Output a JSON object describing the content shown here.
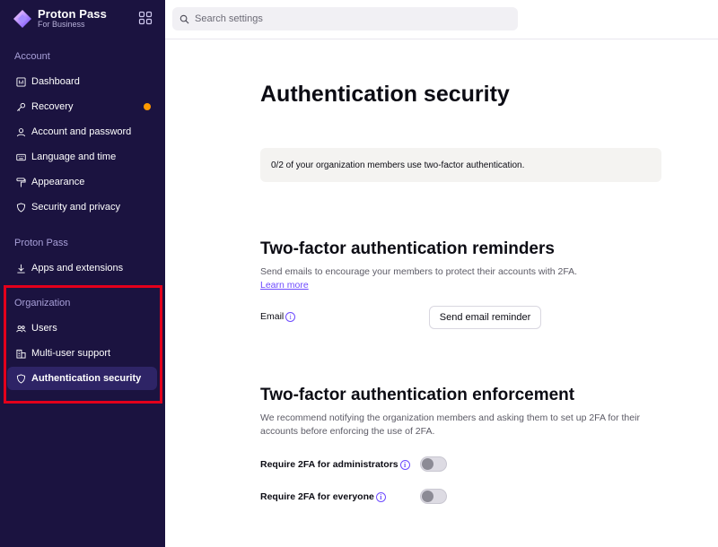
{
  "brand": {
    "name": "Proton Pass",
    "sub": "For Business"
  },
  "search": {
    "placeholder": "Search settings"
  },
  "sidebar": {
    "sections": [
      {
        "title": "Account",
        "items": [
          {
            "label": "Dashboard",
            "icon": "dashboard-icon"
          },
          {
            "label": "Recovery",
            "icon": "key-icon",
            "badge": "warning-dot"
          },
          {
            "label": "Account and password",
            "icon": "user-icon"
          },
          {
            "label": "Language and time",
            "icon": "keyboard-icon"
          },
          {
            "label": "Appearance",
            "icon": "paint-roller-icon"
          },
          {
            "label": "Security and privacy",
            "icon": "shield-icon"
          }
        ]
      },
      {
        "title": "Proton Pass",
        "items": [
          {
            "label": "Apps and extensions",
            "icon": "download-icon"
          }
        ]
      },
      {
        "title": "Organization",
        "items": [
          {
            "label": "Users",
            "icon": "users-icon"
          },
          {
            "label": "Multi-user support",
            "icon": "building-icon"
          },
          {
            "label": "Authentication security",
            "icon": "shield-icon",
            "active": true
          }
        ]
      }
    ]
  },
  "main": {
    "title": "Authentication security",
    "info": "0/2 of your organization members use two-factor authentication.",
    "reminders": {
      "heading": "Two-factor authentication reminders",
      "description": "Send emails to encourage your members to protect their accounts with 2FA.",
      "learn_more": "Learn more",
      "email_label": "Email",
      "button": "Send email reminder"
    },
    "enforcement": {
      "heading": "Two-factor authentication enforcement",
      "description": "We recommend notifying the organization members and asking them to set up 2FA for their accounts before enforcing the use of 2FA.",
      "admins_label": "Require 2FA for administrators",
      "everyone_label": "Require 2FA for everyone",
      "admins_enabled": false,
      "everyone_enabled": false
    }
  },
  "colors": {
    "sidebar_bg": "#1b1340",
    "accent": "#6d4aff",
    "warning": "#ff9900",
    "highlight": "#e3001b"
  }
}
